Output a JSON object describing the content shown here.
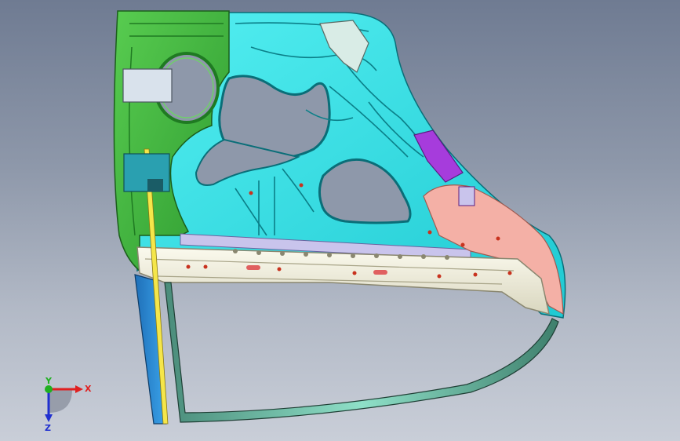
{
  "viewport": {
    "background_top": "#6f7b92",
    "background_bottom": "#c9ced8"
  },
  "model": {
    "colors": {
      "hinge_zone": "#3cb43c",
      "inner_panel": "#2ee6ea",
      "lower_beam": "#f2f0dc",
      "window_seal": "#6fd0b6",
      "belt_strip": "#c9c4ec",
      "corner_reinforcement": "#f4b0a6",
      "mirror_bracket": "#a63cdc",
      "front_pillar": "#2a8cd8",
      "guide_rail": "#f5e64a"
    }
  },
  "triad": {
    "x_label": "X",
    "y_label": "Y",
    "z_label": "Z",
    "x_color": "#e02020",
    "y_color": "#20b020",
    "z_color": "#2030d0"
  }
}
